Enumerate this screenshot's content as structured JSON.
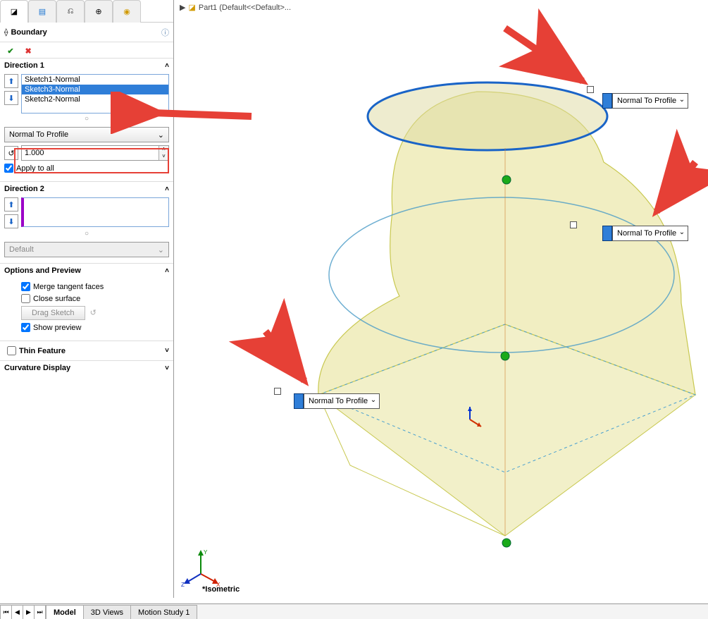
{
  "breadcrumb": {
    "part_label": "Part1  (Default<<Default>..."
  },
  "panel": {
    "title": "Boundary",
    "direction1": {
      "heading": "Direction 1",
      "items": [
        "Sketch1-Normal",
        "Sketch3-Normal",
        "Sketch2-Normal"
      ],
      "selected_index": 1,
      "tangent_option": "Normal To Profile",
      "influence": "1.000",
      "apply_all_label": "Apply to all",
      "apply_all": true
    },
    "direction2": {
      "heading": "Direction 2",
      "default_option": "Default"
    },
    "options": {
      "heading": "Options and Preview",
      "merge_label": "Merge tangent faces",
      "merge": true,
      "close_label": "Close surface",
      "close": false,
      "drag_label": "Drag Sketch",
      "preview_label": "Show preview",
      "preview": true
    },
    "thin_label": "Thin Feature",
    "curvature_label": "Curvature Display"
  },
  "viewport": {
    "orientation_label": "*Isometric",
    "callouts": {
      "top": "Normal To Profile",
      "mid": "Normal To Profile",
      "bottom": "Normal To Profile"
    }
  },
  "bottom_tabs": {
    "items": [
      "Model",
      "3D Views",
      "Motion Study 1"
    ],
    "active": 0
  }
}
